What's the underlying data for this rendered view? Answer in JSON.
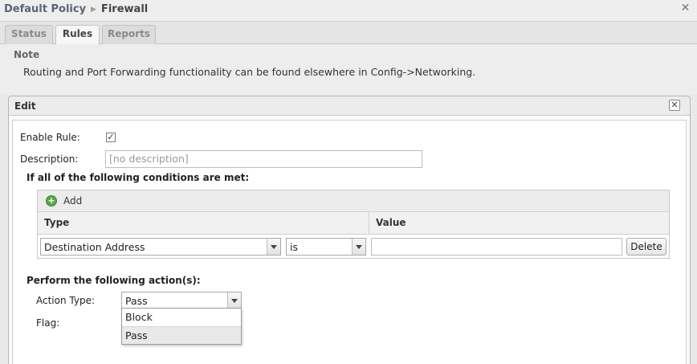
{
  "breadcrumb": {
    "parent": "Default Policy",
    "current": "Firewall"
  },
  "tabs": [
    {
      "label": "Status"
    },
    {
      "label": "Rules"
    },
    {
      "label": "Reports"
    }
  ],
  "active_tab": "Rules",
  "note": {
    "title": "Note",
    "text": "Routing and Port Forwarding functionality can be found elsewhere in Config->Networking."
  },
  "dialog": {
    "title": "Edit",
    "enable_rule_label": "Enable Rule:",
    "enable_rule_checked": true,
    "description_label": "Description:",
    "description_value": "",
    "description_placeholder": "[no description]",
    "conditions_title": "If all of the following conditions are met:",
    "add_label": "Add",
    "columns": {
      "type": "Type",
      "value": "Value"
    },
    "condition_row": {
      "type": "Destination Address",
      "operator": "is",
      "value": "",
      "delete_label": "Delete"
    },
    "actions_title": "Perform the following action(s):",
    "action_type_label": "Action Type:",
    "action_type_value": "Pass",
    "flag_label": "Flag:",
    "action_options": [
      "Block",
      "Pass"
    ],
    "highlighted_option": "Pass"
  },
  "icons": {
    "breadcrumb_separator": "chevron-right-icon",
    "close": "close-icon",
    "add": "add-circle-icon",
    "dropdown": "chevron-down-icon",
    "checkbox": "checkmark-icon"
  },
  "colors": {
    "add_icon": "#57a846",
    "breadcrumb_link": "#5b6470"
  }
}
